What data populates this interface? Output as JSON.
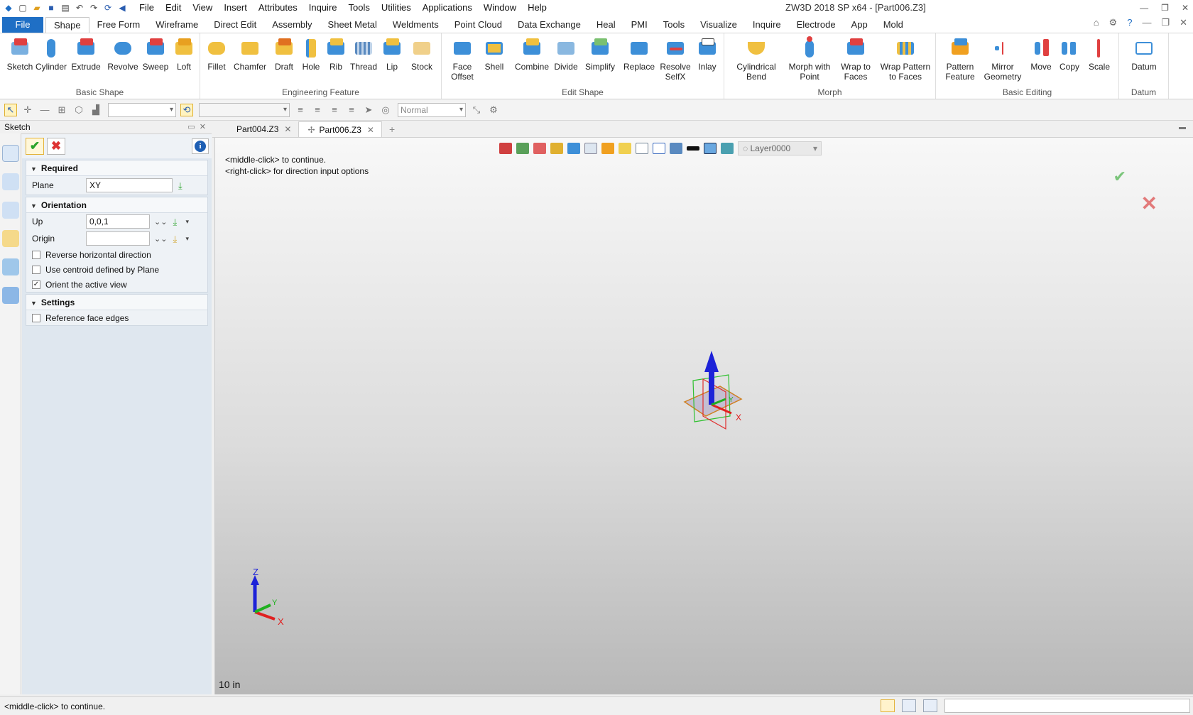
{
  "app": {
    "title": "ZW3D 2018 SP x64 - [Part006.Z3]",
    "menu": [
      "File",
      "Edit",
      "View",
      "Insert",
      "Attributes",
      "Inquire",
      "Tools",
      "Utilities",
      "Applications",
      "Window",
      "Help"
    ]
  },
  "ribbon_tabs": [
    "File",
    "Shape",
    "Free Form",
    "Wireframe",
    "Direct Edit",
    "Assembly",
    "Sheet Metal",
    "Weldments",
    "Point Cloud",
    "Data Exchange",
    "Heal",
    "PMI",
    "Tools",
    "Visualize",
    "Inquire",
    "Electrode",
    "App",
    "Mold"
  ],
  "active_ribbon_tab": "Shape",
  "ribbon": {
    "basic_shape": {
      "label": "Basic Shape",
      "buttons": [
        "Sketch",
        "Cylinder",
        "Extrude",
        "Revolve",
        "Sweep",
        "Loft"
      ]
    },
    "engineering_feature": {
      "label": "Engineering Feature",
      "buttons": [
        "Fillet",
        "Chamfer",
        "Draft",
        "Hole",
        "Rib",
        "Thread",
        "Lip",
        "Stock"
      ]
    },
    "edit_shape": {
      "label": "Edit Shape",
      "buttons": [
        "Face Offset",
        "Shell",
        "Combine",
        "Divide",
        "Simplify",
        "Replace",
        "Resolve SelfX",
        "Inlay"
      ]
    },
    "morph": {
      "label": "Morph",
      "buttons": [
        "Cylindrical Bend",
        "Morph with Point",
        "Wrap to Faces",
        "Wrap Pattern to Faces"
      ]
    },
    "basic_editing": {
      "label": "Basic Editing",
      "buttons": [
        "Pattern Feature",
        "Mirror Geometry",
        "Move",
        "Copy",
        "Scale"
      ]
    },
    "datum": {
      "label": "Datum",
      "buttons": [
        "Datum"
      ]
    }
  },
  "toolbar": {
    "render_mode": "Normal"
  },
  "panel": {
    "title": "Sketch",
    "required": {
      "header": "Required",
      "plane_label": "Plane",
      "plane_value": "XY"
    },
    "orientation": {
      "header": "Orientation",
      "up_label": "Up",
      "up_value": "0,0,1",
      "origin_label": "Origin",
      "origin_value": "",
      "reverse_label": "Reverse horizontal direction",
      "reverse_checked": false,
      "centroid_label": "Use centroid defined by Plane",
      "centroid_checked": false,
      "orient_label": "Orient the active view",
      "orient_checked": true
    },
    "settings": {
      "header": "Settings",
      "ref_edges_label": "Reference face edges",
      "ref_edges_checked": false
    }
  },
  "doc_tabs": [
    {
      "label": "Part004.Z3",
      "active": false
    },
    {
      "label": "Part006.Z3",
      "active": true
    }
  ],
  "viewport": {
    "layer": "Layer0000",
    "hint_line1": "<middle-click> to continue.",
    "hint_line2": "<right-click> for direction input options",
    "scale": "10 in",
    "axis_x": "X",
    "axis_y": "Y",
    "axis_z": "Z"
  },
  "status": {
    "text": "<middle-click> to continue."
  },
  "colors": {
    "file_tab": "#1f6fc5",
    "confirm": "#2aa32a",
    "cancel": "#d33333",
    "axis_x": "#e02020",
    "axis_y": "#20b020",
    "axis_z": "#2030e0"
  }
}
